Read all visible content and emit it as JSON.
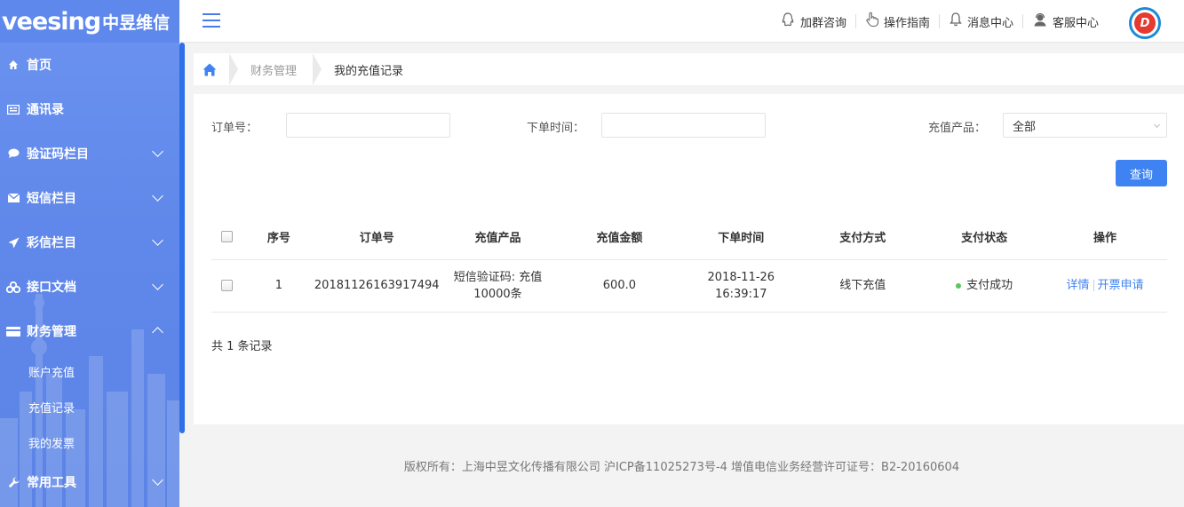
{
  "brand": {
    "logo_latin": "veesing",
    "logo_cn": "中昱维信"
  },
  "sidebar": {
    "items": [
      {
        "label": "首页",
        "icon": "home-icon"
      },
      {
        "label": "通讯录",
        "icon": "contacts-icon"
      },
      {
        "label": "验证码栏目",
        "icon": "chat-icon",
        "expandable": true
      },
      {
        "label": "短信栏目",
        "icon": "mail-icon",
        "expandable": true
      },
      {
        "label": "彩信栏目",
        "icon": "send-icon",
        "expandable": true
      },
      {
        "label": "接口文档",
        "icon": "api-icon",
        "expandable": true
      },
      {
        "label": "财务管理",
        "icon": "card-icon",
        "expanded": true,
        "children": [
          "账户充值",
          "充值记录",
          "我的发票"
        ]
      },
      {
        "label": "常用工具",
        "icon": "wrench-icon",
        "expandable": true
      }
    ]
  },
  "topbar": {
    "links": [
      {
        "label": "加群咨询",
        "icon": "qq-icon"
      },
      {
        "label": "操作指南",
        "icon": "pointer-hand-icon"
      },
      {
        "label": "消息中心",
        "icon": "bell-icon"
      },
      {
        "label": "客服中心",
        "icon": "support-agent-icon"
      }
    ],
    "avatar_text": "D"
  },
  "breadcrumb": {
    "parent": "财务管理",
    "current": "我的充值记录"
  },
  "filters": {
    "order_label": "订单号：",
    "order_value": "",
    "time_label": "下单时间：",
    "time_value": "",
    "product_label": "充值产品：",
    "product_value": "全部",
    "query_label": "查询"
  },
  "table": {
    "headers": [
      "序号",
      "订单号",
      "充值产品",
      "充值金额",
      "下单时间",
      "支付方式",
      "支付状态",
      "操作"
    ],
    "rows": [
      {
        "index": "1",
        "order_no": "20181126163917494",
        "product_line1": "短信验证码: 充值",
        "product_line2": "10000条",
        "amount": "600.0",
        "date": "2018-11-26",
        "time": "16:39:17",
        "pay_method": "线下充值",
        "pay_status": "支付成功",
        "op_detail": "详情",
        "op_invoice": "开票申请"
      }
    ]
  },
  "summary": "共 1 条记录",
  "footer": "版权所有：上海中昱文化传播有限公司 沪ICP备11025273号-4 增值电信业务经营许可证号：B2-20160604",
  "colors": {
    "sidebar": "#6088ea",
    "accent": "#3f83f2",
    "success": "#5dc55d"
  }
}
